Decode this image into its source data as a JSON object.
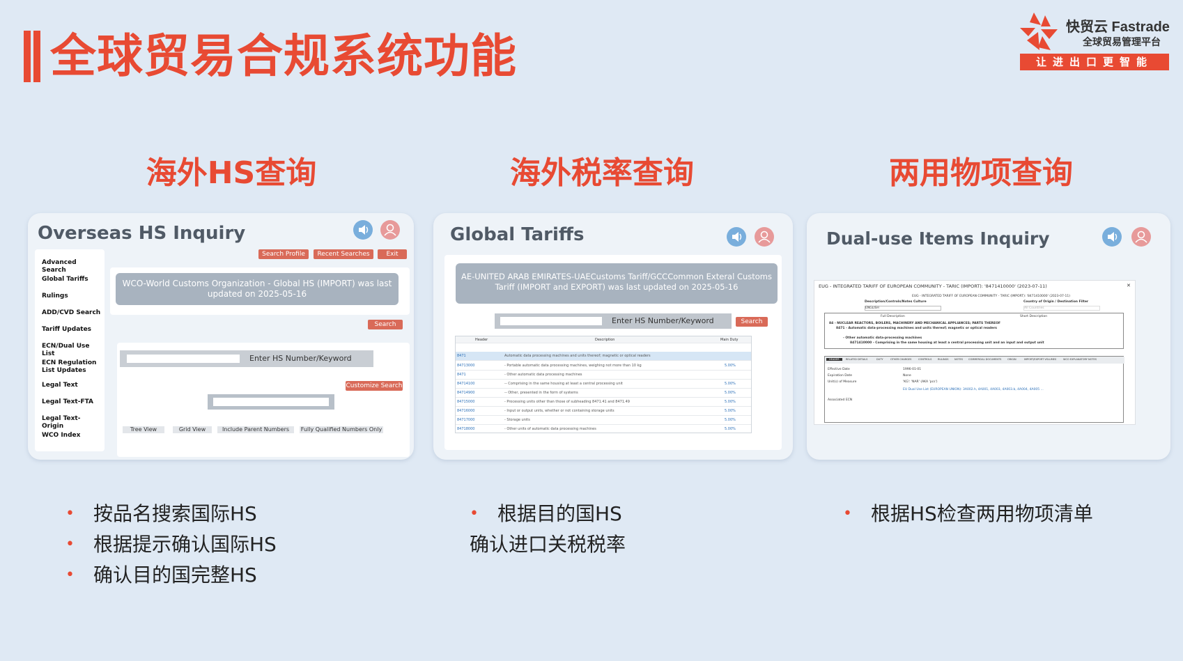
{
  "page_title": "全球贸易合规系统功能",
  "logo": {
    "brand": "快贸云 Fastrade",
    "subtitle": "全球贸易管理平台",
    "slogan": "让进出口更智能"
  },
  "sections": [
    {
      "heading": "海外HS查询"
    },
    {
      "heading": "海外税率查询"
    },
    {
      "heading": "两用物项查询"
    }
  ],
  "card1": {
    "title": "Overseas HS Inquiry",
    "top_buttons": [
      "Search Profile",
      "Recent Searches",
      "Exit"
    ],
    "sidebar": [
      "Advanced Search",
      "Global Tariffs",
      "Rulings",
      "ADD/CVD Search",
      "Tariff Updates",
      "ECN/Dual Use List",
      "ECN Regulation List Updates",
      "Legal Text",
      "Legal Text-FTA",
      "Legal Text-Origin",
      "WCO Index"
    ],
    "banner": "WCO-World Customs Organization - Global HS (IMPORT) was last updated on 2025-05-16",
    "search_button": "Search",
    "input_label": "Enter HS Number/Keyword",
    "customize_button": "Customize Search",
    "view_options": [
      "Tree View",
      "Grid View",
      "Include  Parent  Numbers",
      "Fully Qualified Numbers Only"
    ]
  },
  "card2": {
    "title": "Global Tariffs",
    "banner": "AE-UNITED ARAB EMIRATES-UAECustoms Tariff/GCCCommon Exteral Customs Tariff (IMPORT and EXPORT) was last updated on 2025-05-16",
    "input_label": "Enter HS Number/Keyword",
    "search_button": "Search",
    "table_headers": [
      "Header",
      "Description",
      "Main Duty"
    ],
    "rows": [
      {
        "code": "8471",
        "desc": "Automatic data processing machines and units thereof; magnetic or optical readers",
        "rate": ""
      },
      {
        "code": "84713000",
        "desc": "- Portable automatic data processing machines, weighing not more than 10 kg",
        "rate": "5.00%"
      },
      {
        "code": "8471",
        "desc": "- Other automatic data processing machines",
        "rate": ""
      },
      {
        "code": "84714100",
        "desc": "-- Comprising in the same housing at least a central processing unit",
        "rate": "5.00%"
      },
      {
        "code": "84714900",
        "desc": "-- Other, presented in the form of systems",
        "rate": "5.00%"
      },
      {
        "code": "84715000",
        "desc": "- Processing units other than those of subheading 8471.41 and 8471.49",
        "rate": "5.00%"
      },
      {
        "code": "84716000",
        "desc": "- Input or output units, whether or not containing storage units",
        "rate": "5.00%"
      },
      {
        "code": "84717000",
        "desc": "- Storage units",
        "rate": "5.00%"
      },
      {
        "code": "84718000",
        "desc": "- Other units of automatic data processing machines",
        "rate": "5.00%"
      }
    ]
  },
  "card3": {
    "title": "Dual-use Items Inquiry",
    "doc_title": "EUG - INTEGRATED TARIFF OF EUROPEAN COMMUNITY - TARIC (IMPORT): '8471410000' (2023-07-11)",
    "doc_subtitle": "EUG - INTEGRATED TARIFF OF EUROPEAN COMMUNITY - TARIC (IMPORT): '8471410000' (2023-07-11)",
    "filter_labels": [
      "Description/Controls/Notes Culture",
      "Country of Origin / Destination Filter"
    ],
    "language": "ENGLISH",
    "countries": "All Countries",
    "radio_options": [
      "Full Description",
      "Short Description"
    ],
    "tree": [
      "84 - NUCLEAR REACTORS, BOILERS, MACHINERY AND MECHANICAL APPLIANCES; PARTS THEREOF",
      "8471 - Automatic data-processing machines and units thereof; magnetic or optical readers",
      "- Other automatic data-processing machines",
      "8471410000 - Comprising in the same housing at least a central processing unit and an input and output unit"
    ],
    "tabs": [
      "HEADER",
      "RELATED DETAILS",
      "DUTY",
      "OTHER CHARGES",
      "CONTROLS",
      "RULINGS",
      "NOTES",
      "COMMERCIAL DOCUMENTS",
      "ORIGIN",
      "IMPORT/EXPORT VOLUMES",
      "WCO EXPLANATORY NOTES"
    ],
    "fields": [
      {
        "label": "Effective Date",
        "value": "1996-01-01"
      },
      {
        "label": "Expiration Date",
        "value": "None"
      },
      {
        "label": "Unit(s) of Measure",
        "value": "'KG': 'NAR' (AKA 'pcs')"
      },
      {
        "label": "Associated ECN",
        "value": "EU Dual Use List (EUROPEAN UNION): 3A002.h, 4A001, 4A003, 4A003.b, 4A004, 4A005 ..."
      }
    ]
  },
  "bullets": {
    "col1": [
      "按品名搜索国际HS",
      "根据提示确认国际HS",
      "确认目的国完整HS"
    ],
    "col2_first": "根据目的国HS",
    "col2_second": "确认进口关税税率",
    "col3": [
      "根据HS检查两用物项清单"
    ]
  }
}
